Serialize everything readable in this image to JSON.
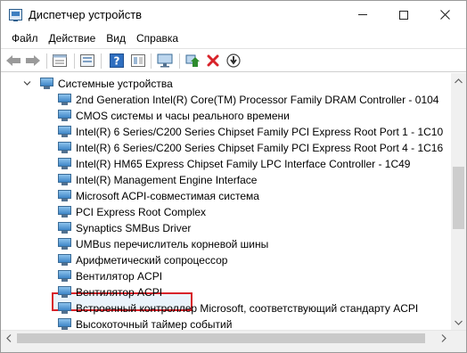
{
  "window": {
    "title": "Диспетчер устройств"
  },
  "menu": [
    "Файл",
    "Действие",
    "Вид",
    "Справка"
  ],
  "toolbar_icons": [
    "back-arrow-icon",
    "forward-arrow-icon",
    "properties-icon",
    "driver-update-icon",
    "help-icon",
    "hidden-devices-icon",
    "monitor-icon",
    "enable-device-icon",
    "uninstall-device-icon",
    "scan-hardware-icon"
  ],
  "tree": {
    "category": "Системные устройства",
    "devices": [
      "2nd Generation Intel(R) Core(TM) Processor Family DRAM Controller - 0104",
      "CMOS системы и часы реального времени",
      "Intel(R) 6 Series/C200 Series Chipset Family PCI Express Root Port 1 - 1C10",
      "Intel(R) 6 Series/C200 Series Chipset Family PCI Express Root Port 4 - 1C16",
      "Intel(R) HM65 Express Chipset Family LPC Interface Controller - 1C49",
      "Intel(R) Management Engine Interface",
      "Microsoft ACPI-совместимая система",
      "PCI Express Root Complex",
      "Synaptics SMBus Driver",
      "UMBus перечислитель корневой шины",
      "Арифметический сопроцессор",
      "Вентилятор ACPI",
      "Вентилятор ACPI",
      "Встроенный контроллер Microsoft, соответствующий стандарту ACPI",
      "Высокоточный таймер событий"
    ],
    "selected_device": "Synaptics SMBus Driver"
  },
  "colors": {
    "highlight_border": "#d8232a",
    "device_icon": "#3f86c8",
    "delete_icon": "#d8232a",
    "enable_icon": "#2e8b2e"
  }
}
